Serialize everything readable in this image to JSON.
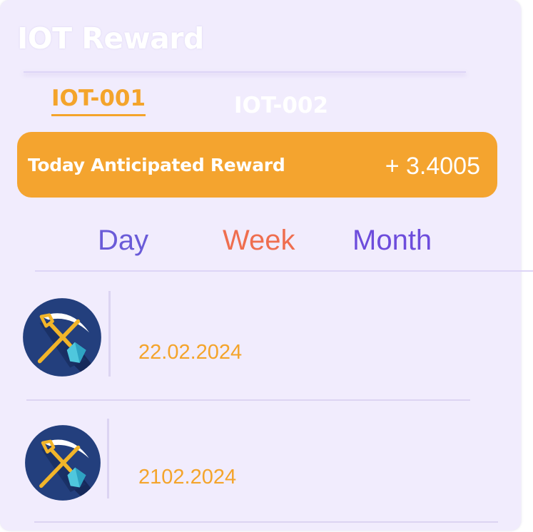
{
  "header": {
    "title": "IOT Reward"
  },
  "tabs": [
    {
      "label": "IOT-001",
      "active": true
    },
    {
      "label": "IOT-002",
      "active": false
    }
  ],
  "reward": {
    "label": "Today Anticipated Reward",
    "value": "+ 3.4005"
  },
  "periods": [
    {
      "label": "Day"
    },
    {
      "label": "Week"
    },
    {
      "label": "Month"
    }
  ],
  "records": [
    {
      "icon": "mining-icon",
      "date": "22.02.2024"
    },
    {
      "icon": "mining-icon",
      "date": "2102.2024"
    }
  ],
  "colors": {
    "accent": "#f4a42b",
    "card_background": "#f1ecfd",
    "day": "#6a5bd8",
    "week": "#ef6e4f",
    "month": "#6d4cdc"
  }
}
